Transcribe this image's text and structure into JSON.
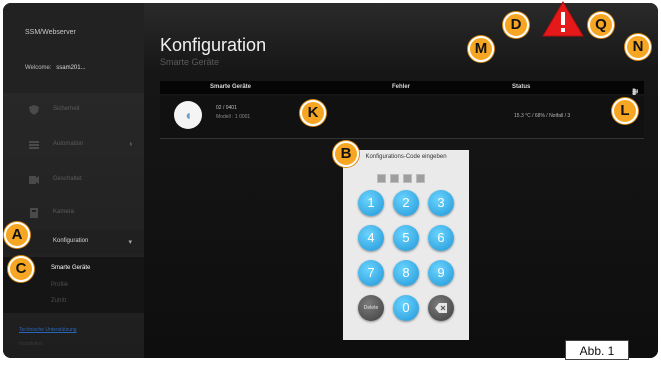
{
  "sidebar": {
    "brand": "SSM/Webserver",
    "welcome_prefix": "Welcome:",
    "welcome_user": "ssam201...",
    "items": [
      {
        "label": "Sicherheit",
        "icon": "shield-icon"
      },
      {
        "label": "Automation",
        "icon": "automation-icon"
      },
      {
        "label": "Geschaltet",
        "icon": "switch-icon"
      },
      {
        "label": "Kamera",
        "icon": "camera-icon"
      },
      {
        "label": "Konfiguration",
        "icon": "gear-icon"
      }
    ],
    "subitems": [
      "Smarte Geräte",
      "Profile",
      "Zutritt"
    ],
    "support_link": "Technische Unterstützung",
    "support_text": "Installation"
  },
  "main": {
    "title": "Konfiguration",
    "subtitle": "Smarte Geräte",
    "columns": [
      "Smarte Geräte",
      "Fehler",
      "Status"
    ],
    "toolbar_icons": [
      "search-icon",
      "plus-icon",
      "wifi-icon",
      "refresh-icon",
      "trash-icon"
    ],
    "device": {
      "name": "02 / 0401",
      "meta": "Modell : 1 0001",
      "status": "15.3 °C / 68% / Notfall / 3"
    }
  },
  "dialog": {
    "title": "Konfigurations-Code eingeben",
    "keys": [
      "1",
      "2",
      "3",
      "4",
      "5",
      "6",
      "7",
      "8",
      "9",
      "Delete",
      "0",
      "backspace-icon"
    ]
  },
  "callouts": [
    "A",
    "B",
    "C",
    "D",
    "K",
    "L",
    "M",
    "N",
    "Q"
  ],
  "figure_caption": "Abb. 1",
  "colors": {
    "callout": "#f6a623",
    "key": "#2196d6",
    "warning": "#e51919"
  }
}
